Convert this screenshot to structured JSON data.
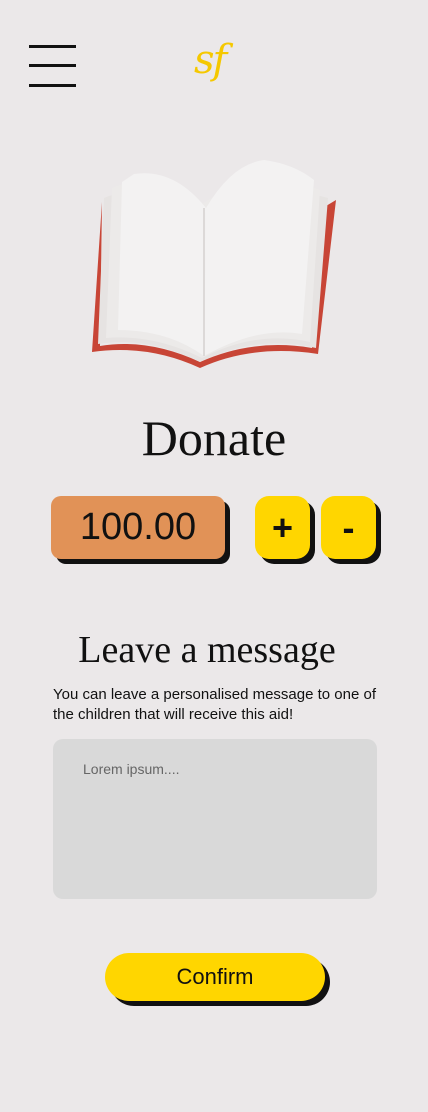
{
  "header": {
    "logo_text": "sf",
    "menu_icon": "hamburger-menu-icon",
    "logo_color": "#F5C800"
  },
  "hero": {
    "icon": "open-book-illustration"
  },
  "donate": {
    "title": "Donate",
    "amount": "100.00",
    "increment_label": "+",
    "decrement_label": "-",
    "amount_color": "#E19257",
    "button_color": "#FFD600"
  },
  "message": {
    "title": "Leave a message",
    "description": "You can leave a personalised message to one of the children that will receive this aid!",
    "placeholder": "Lorem ipsum....",
    "value": ""
  },
  "confirm": {
    "label": "Confirm"
  },
  "colors": {
    "background": "#EBE8E9",
    "accent": "#FFD600",
    "input_bg": "#D9D9D9"
  }
}
